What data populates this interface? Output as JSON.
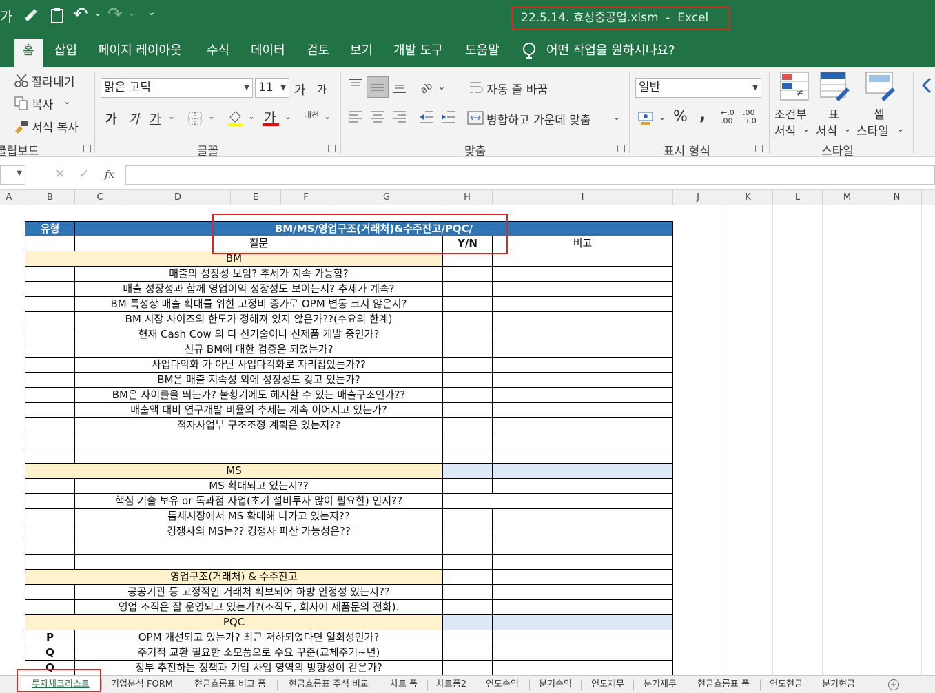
{
  "window": {
    "title": "22.5.14. 효성중공업.xlsm  -  Excel"
  },
  "quick_access": {
    "font_glyph": "가",
    "undo_glyph": "↶",
    "redo_glyph": "↷",
    "more_glyph": "⌄"
  },
  "menu": {
    "tabs": [
      "홈",
      "삽입",
      "페이지 레이아웃",
      "수식",
      "데이터",
      "검토",
      "보기",
      "개발 도구",
      "도움말"
    ],
    "active": "홈",
    "tell_me": "어떤 작업을 원하시나요?"
  },
  "ribbon": {
    "clipboard": {
      "cut": "잘라내기",
      "copy": "복사",
      "format_painter": "서식 복사",
      "label": "클립보드"
    },
    "font": {
      "name": "맑은 고딕",
      "size": "11",
      "grow": "가",
      "shrink": "가",
      "bold": "가",
      "italic": "가",
      "underline": "가",
      "font_color_glyph": "가",
      "phonetic": "내천",
      "label": "글꼴"
    },
    "alignment": {
      "wrap_text": "자동 줄 바꿈",
      "merge_center": "병합하고 가운데 맞춤",
      "label": "맞춤"
    },
    "number": {
      "format": "일반",
      "percent": "%",
      "comma": ",",
      "inc_decimal": "←.0 .00",
      "dec_decimal": ".00 →.0",
      "label": "표시 형식"
    },
    "styles": {
      "conditional_1": "조건부",
      "conditional_2": "서식",
      "table_1": "표",
      "table_2": "서식",
      "cell_1": "셀",
      "cell_2": "스타일",
      "label": "스타일"
    }
  },
  "formula_bar": {
    "cancel": "✕",
    "enter": "✓",
    "fx": "fx",
    "value": ""
  },
  "columns": [
    "A",
    "B",
    "C",
    "D",
    "E",
    "F",
    "G",
    "H",
    "I",
    "J",
    "K",
    "L",
    "M",
    "N"
  ],
  "sheet": {
    "header_type": "유형",
    "header_title": "BM/MS/영업구조(거래처)&수주잔고/PQC/",
    "header_question": "질문",
    "header_yn": "Y/N",
    "header_note": "비고",
    "sections": {
      "bm": "BM",
      "ms": "MS",
      "sales": "영업구조(거래처) & 수주잔고",
      "pqc": "PQC"
    },
    "bm_questions": [
      "매출의 성장성 보임? 추세가 지속 가능함?",
      "매출 성장성과 함께 영업이익 성장성도 보이는지? 추세가 계속?",
      "BM 특성상 매출 확대를 위한 고정비 증가로 OPM 변동 크지 않은지?",
      "BM 시장 사이즈의 한도가 정해져 있지 않은가??(수요의 한계)",
      "현재 Cash Cow 의 타 신기술이나 신제품 개발 중인가?",
      "신규 BM에 대한 검증은 되었는가?",
      "사업다악화 가 아닌 사업다각화로 자리잡았는가??",
      "BM은 매출 지속성 외에 성장성도 갖고 있는가?",
      "BM은 사이클을 띄는가? 불황기에도 헤지할 수 있는 매출구조인가??",
      "매출액 대비 연구개발 비율의 추세는 계속 이어지고 있는가?",
      "적자사업부 구조조정 계획은 있는지??"
    ],
    "ms_questions": [
      "MS 확대되고 있는지??",
      "핵심 기술 보유 or 독과점 사업(초기 설비투자 많이 필요한) 인지??",
      "틈새시장에서 MS 확대해 나가고 있는지??",
      "경쟁사의 MS는?? 경쟁사 파산 가능성은??"
    ],
    "sales_questions": [
      "공공기관 등 고정적인 거래처 확보되어 하방 안정성 있는지??",
      "영업 조직은 잘 운영되고 있는가?(조직도, 회사에 제품문의 전화)."
    ],
    "pqc_rows": [
      {
        "type": "P",
        "question": "OPM 개선되고 있는가? 최근 저하되었다면 일회성인가?"
      },
      {
        "type": "Q",
        "question": "주기적 교환 필요한 소모품으로 수요 꾸준(교체주기~년)"
      },
      {
        "type": "Q",
        "question": "정부 추진하는 정책과 기업 사업 영역의 방향성이 같은가?"
      }
    ]
  },
  "sheet_tabs": [
    "투자체크리스트",
    "기업분석 FORM",
    "현금흐름표 비교 폼",
    "현금흐름표 주석 비교",
    "차트 폼",
    "차트폼2",
    "연도손익",
    "분기손익",
    "연도재무",
    "분기재무",
    "현금흐름표 폼",
    "연도현금",
    "분기현금"
  ],
  "active_sheet": "투자체크리스트",
  "colors": {
    "excel_green": "#217346",
    "header_blue": "#2e75b6",
    "section_yellow": "#fff2cc",
    "highlight_red": "#e8211e"
  }
}
